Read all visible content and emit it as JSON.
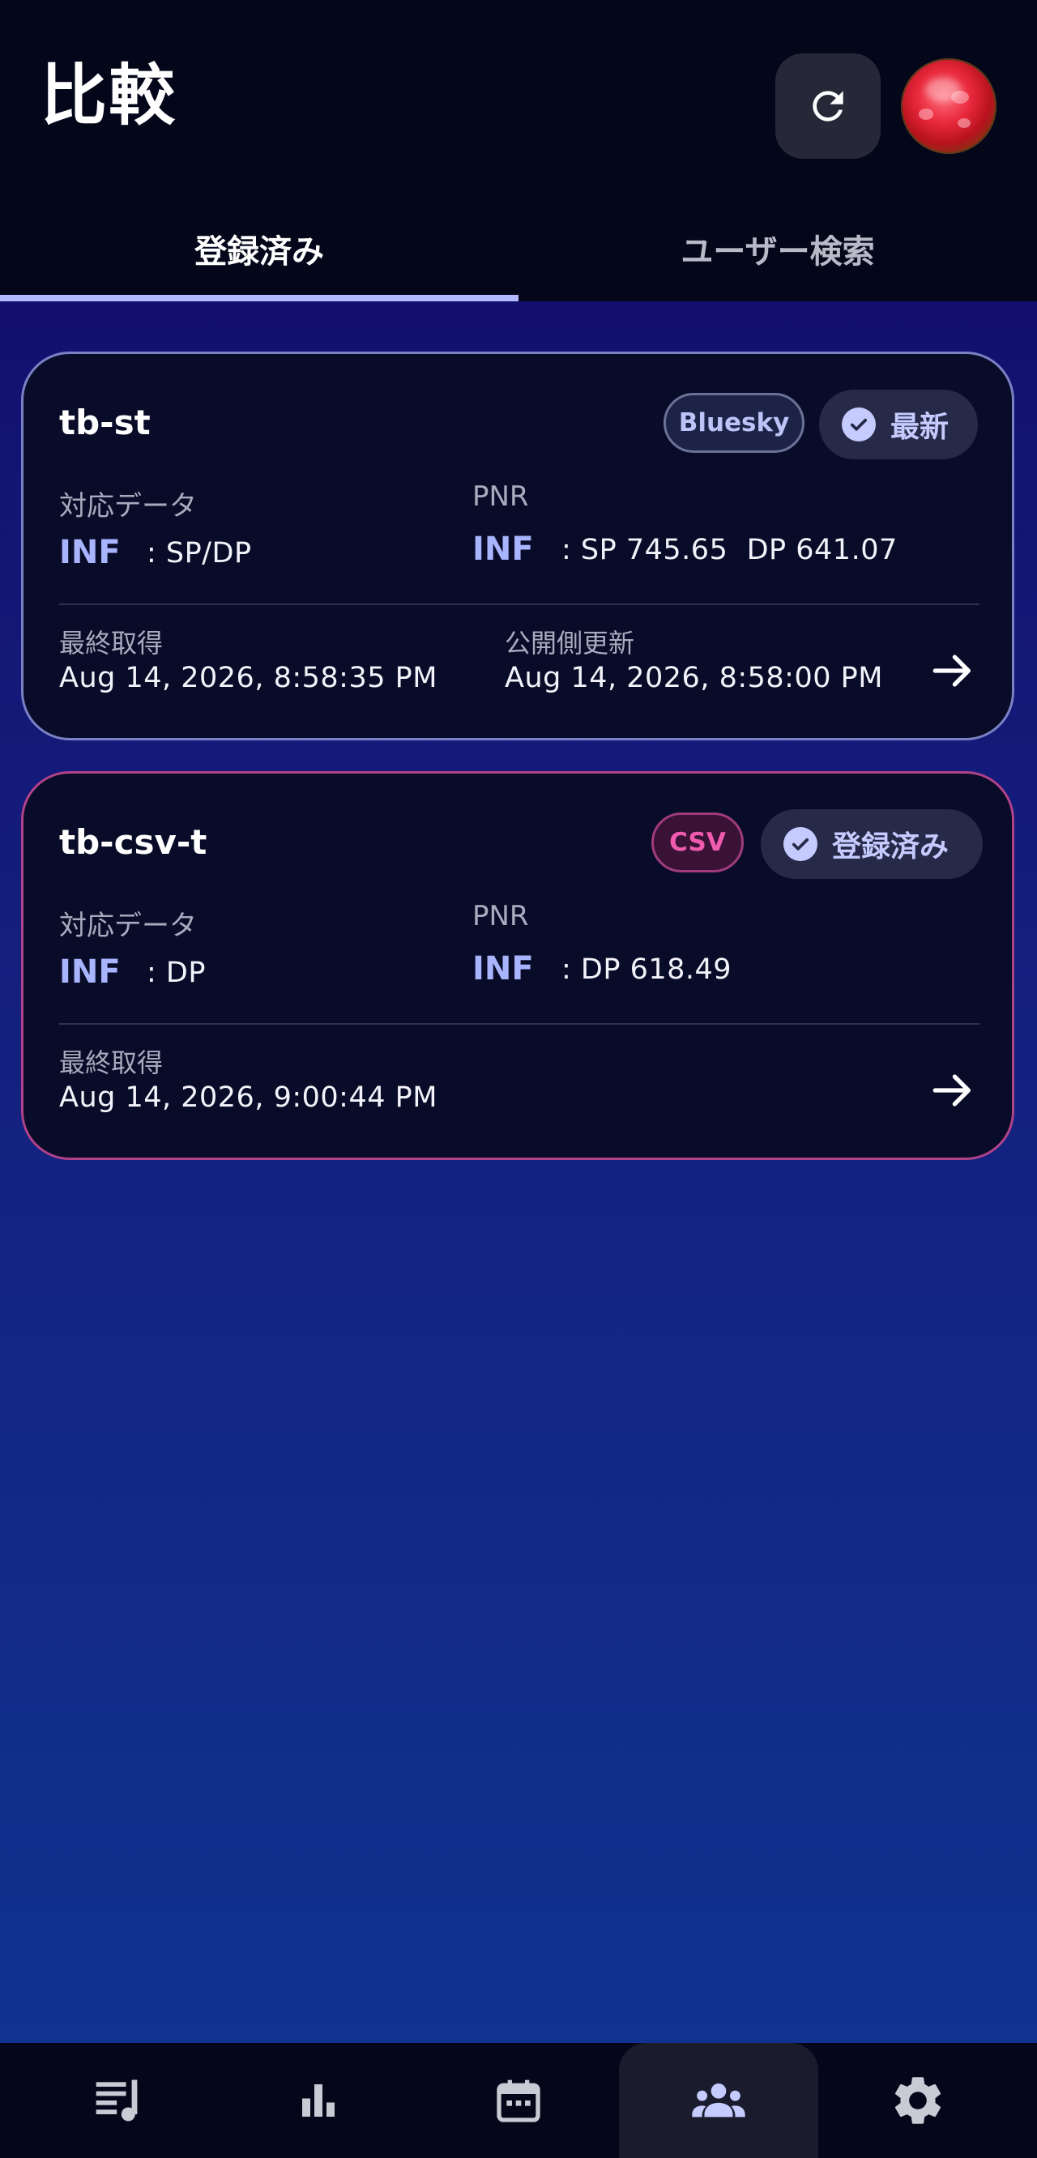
{
  "header": {
    "title": "比較"
  },
  "tabs": [
    {
      "label": "登録済み",
      "active": true
    },
    {
      "label": "ユーザー検索",
      "active": false
    }
  ],
  "cards": [
    {
      "name": "tb-st",
      "source_badge": "Bluesky",
      "status_badge": "最新",
      "data_label": "対応データ",
      "data_mode": "INF",
      "data_value": ": SP/DP",
      "pnr_label": "PNR",
      "pnr_mode": "INF",
      "pnr_value": ": SP 745.65  DP 641.07",
      "last_fetched_label": "最終取得",
      "last_fetched_value": "Aug 14, 2026, 8:58:35 PM",
      "public_updated_label": "公開側更新",
      "public_updated_value": "Aug 14, 2026, 8:58:00 PM"
    },
    {
      "name": "tb-csv-t",
      "source_badge": "CSV",
      "status_badge": "登録済み",
      "data_label": "対応データ",
      "data_mode": "INF",
      "data_value": ": DP",
      "pnr_label": "PNR",
      "pnr_mode": "INF",
      "pnr_value": ": DP 618.49",
      "last_fetched_label": "最終取得",
      "last_fetched_value": "Aug 14, 2026, 9:00:44 PM"
    }
  ],
  "bottom_nav": [
    {
      "icon": "playlist-music-icon",
      "active": false
    },
    {
      "icon": "bar-chart-icon",
      "active": false
    },
    {
      "icon": "calendar-icon",
      "active": false
    },
    {
      "icon": "people-group-icon",
      "active": true
    },
    {
      "icon": "gear-icon",
      "active": false
    }
  ],
  "colors": {
    "accent": "#b3b9ff",
    "card1_border": "#7a81c4",
    "card2_border": "#b0428a",
    "csv_badge": "#f05bb0"
  }
}
